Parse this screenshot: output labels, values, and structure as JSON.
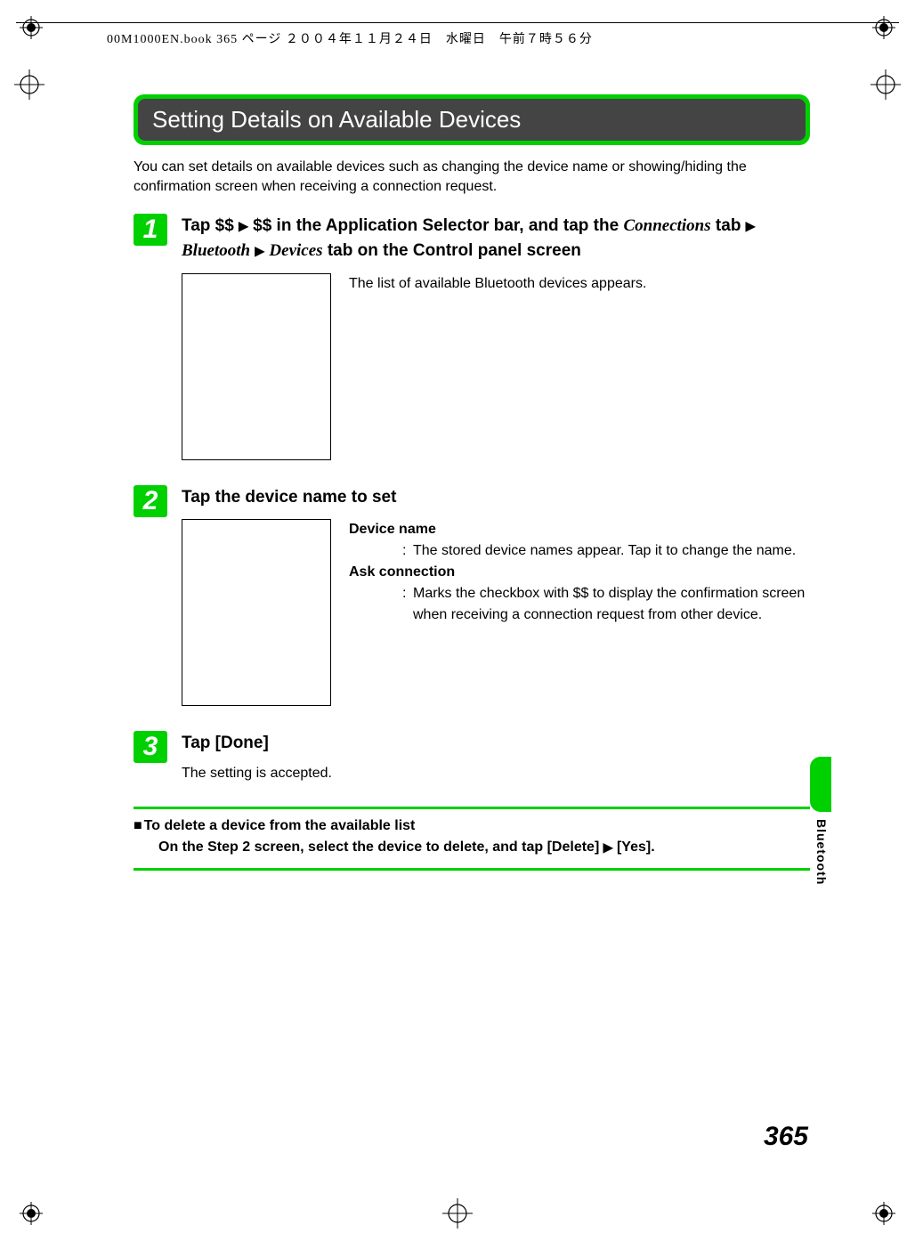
{
  "meta_header": "00M1000EN.book  365 ページ  ２００４年１１月２４日　水曜日　午前７時５６分",
  "section_title": "Setting Details on Available Devices",
  "intro": "You can set details on available devices such as changing the device name or showing/hiding the confirmation screen when receiving a connection request.",
  "steps": [
    {
      "num": "1",
      "title_parts": {
        "p1": "Tap $$ ",
        "p2": " $$ in the Application Selector bar, and tap the ",
        "conn": "Connections",
        "p3": " tab ",
        "bt": "Bluetooth",
        "p4": " ",
        "dev": "Devices",
        "p5": " tab on the Control panel screen"
      },
      "detail_text": "The list of available Bluetooth devices appears."
    },
    {
      "num": "2",
      "title": "Tap the device name to set",
      "defs": {
        "device_name_label": "Device name",
        "device_name_text": "The stored device names appear. Tap it to change the name.",
        "ask_conn_label": "Ask connection",
        "ask_conn_text": "Marks the checkbox with $$ to display the confirmation screen when receiving a connection request from other device."
      }
    },
    {
      "num": "3",
      "title": "Tap [Done]",
      "sub": "The setting is accepted."
    }
  ],
  "note": {
    "title": "To delete a device from the available list",
    "body_p1": "On the Step 2 screen, select the device to delete, and tap [Delete] ",
    "body_p2": " [Yes]."
  },
  "side_label": "Bluetooth",
  "page_number": "365",
  "arrow": "▶"
}
